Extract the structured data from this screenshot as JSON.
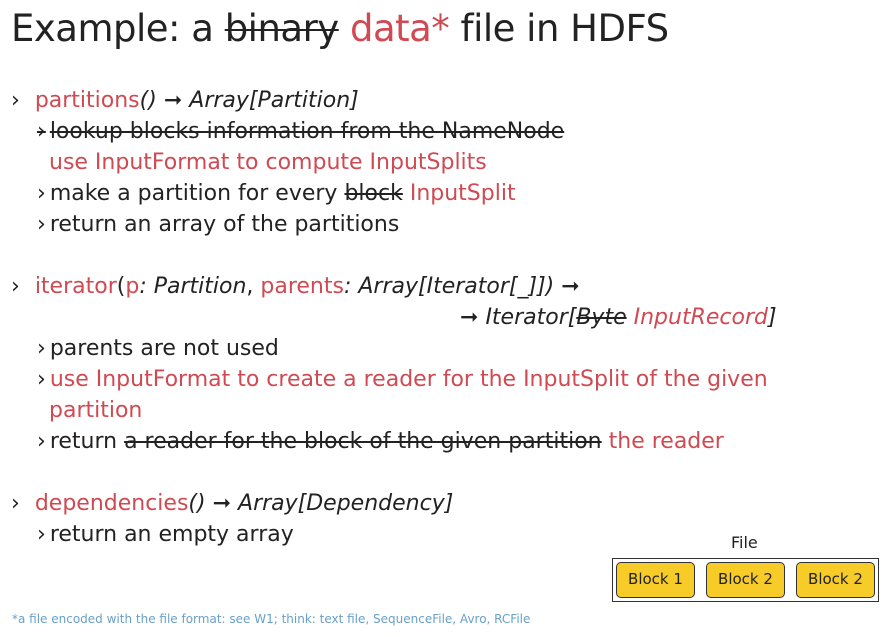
{
  "title": {
    "prefix": "Example: a ",
    "struck": "binary",
    "accent": "data*",
    "suffix": " file in HDFS"
  },
  "bullet_symbol": "›",
  "arrow_symbol": "➞",
  "partitions": {
    "name": "partitions",
    "signature": "() ",
    "return_type": "Array[Partition]",
    "items": {
      "lookup_struck": "lookup blocks information from the NameNode",
      "use_inputformat": "use InputFormat to compute InputSplits",
      "make_prefix": "make a partition for every ",
      "make_struck": "block",
      "make_accent": "InputSplit",
      "return_text": "return an array of the partitions"
    }
  },
  "iterator": {
    "name": "iterator",
    "open_paren": "(",
    "p": "p",
    "p_type": ": Partition",
    "comma": ", ",
    "parents": "parents",
    "parents_type": ": Array[Iterator[_]]) ",
    "ret_prefix": "Iterator[",
    "ret_struck": "Byte",
    "ret_accent": "InputRecord",
    "ret_suffix": "]",
    "items": {
      "parents_unused": "parents are not used",
      "use_reader_line1": "use InputFormat to create a reader for the InputSplit of the given",
      "use_reader_line2": "partition",
      "return_prefix": "return ",
      "return_struck": "a reader for the block of the given partition",
      "return_accent": "the reader"
    }
  },
  "dependencies": {
    "name": "dependencies",
    "signature": "() ",
    "return_type": "Array[Dependency]",
    "items": {
      "return_text": "return an empty array"
    }
  },
  "diagram": {
    "file_label": "File",
    "blocks": [
      "Block 1",
      "Block 2",
      "Block 2"
    ]
  },
  "footnote": "*a file encoded with the file format: see W1; think: text file, SequenceFile, Avro, RCFile",
  "colors": {
    "accent": "#cf4a52",
    "block_fill": "#f7cc28",
    "footnote": "#6aa0c8"
  }
}
